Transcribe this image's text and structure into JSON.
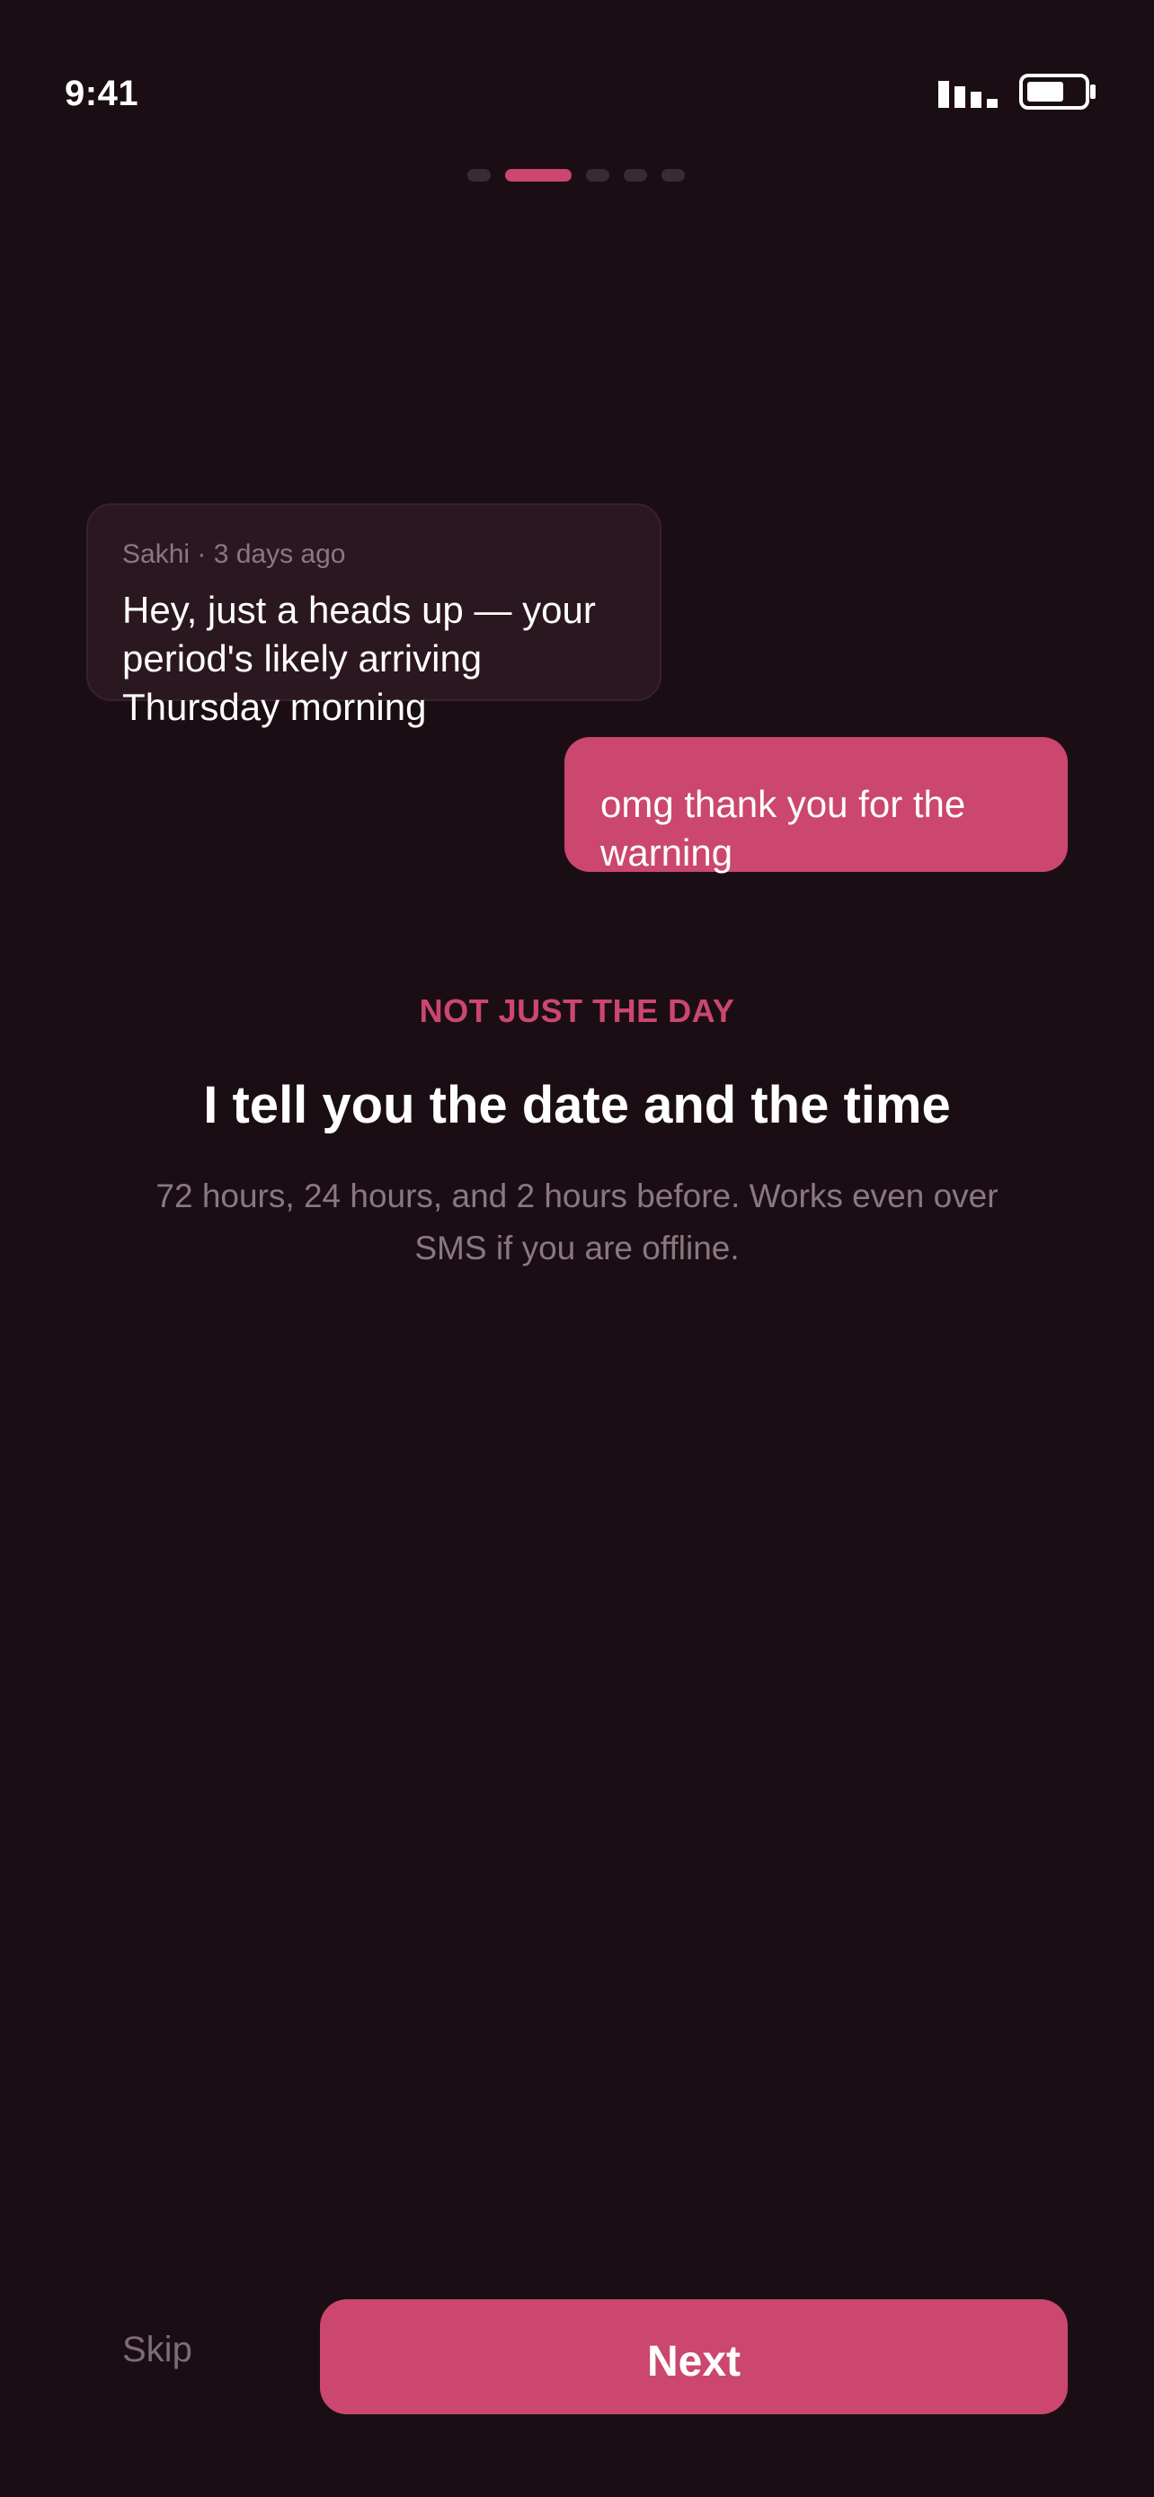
{
  "status_bar": {
    "time": "9:41"
  },
  "pager": {
    "total": 5,
    "active_index": 1
  },
  "chat": {
    "incoming": {
      "meta": "Sakhi · 3 days ago",
      "text": "Hey, just a heads up — your period's likely arriving Thursday morning"
    },
    "outgoing": {
      "text": "omg thank you for the warning"
    }
  },
  "content": {
    "eyebrow": "NOT JUST THE DAY",
    "headline": "I tell you the date and the time",
    "subtitle": "72 hours, 24 hours, and 2 hours before. Works even over SMS if you are offline."
  },
  "footer": {
    "skip_label": "Skip",
    "next_label": "Next"
  },
  "colors": {
    "background": "#1a0e14",
    "accent": "#cb476f",
    "bubble_incoming": "#2b1720",
    "muted_text": "#8a7880"
  },
  "icons": {
    "signal": "cellular-signal-icon",
    "battery": "battery-icon"
  }
}
